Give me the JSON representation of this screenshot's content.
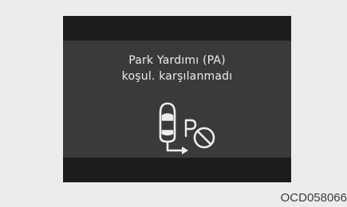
{
  "display": {
    "message_line1": "Park Yardımı (PA)",
    "message_line2": "koşul. karşılanmadı",
    "icon": "parking-assist-unavailable-icon",
    "background_color": "#3a3a3a",
    "bar_color": "#1c1c1c",
    "text_color": "#ededed"
  },
  "caption": {
    "code": "OCD058066"
  }
}
